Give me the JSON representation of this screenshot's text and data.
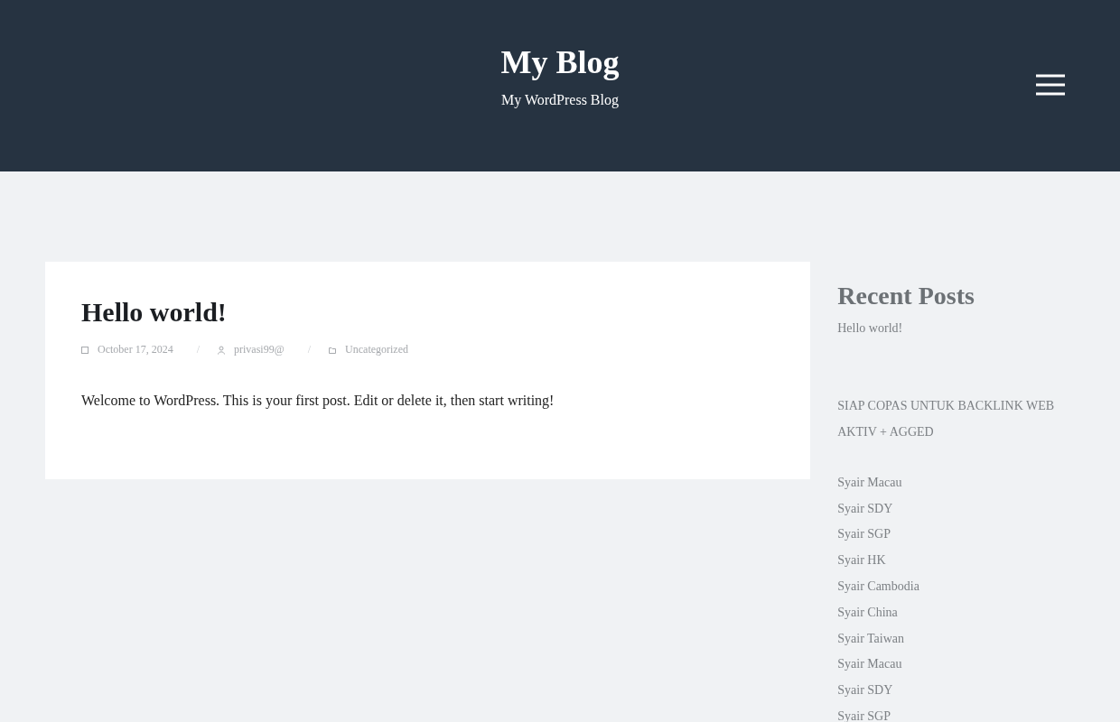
{
  "header": {
    "site_title": "My Blog",
    "tagline": "My WordPress Blog"
  },
  "post": {
    "title": "Hello world!",
    "date": "October 17, 2024",
    "author": "privasi99@",
    "category": "Uncategorized",
    "separator": "/",
    "body": "Welcome to WordPress. This is your first post. Edit or delete it, then start writing!"
  },
  "sidebar": {
    "recent_posts": {
      "title": "Recent Posts",
      "items": [
        "Hello world!"
      ]
    },
    "notice": "SIAP COPAS UNTUK BACKLINK WEB AKTIV + AGGED",
    "links": [
      "Syair Macau",
      "Syair SDY",
      "Syair SGP",
      "Syair HK",
      "Syair Cambodia",
      "Syair China",
      "Syair Taiwan",
      "Syair Macau",
      "Syair SDY",
      "Syair SGP"
    ]
  }
}
